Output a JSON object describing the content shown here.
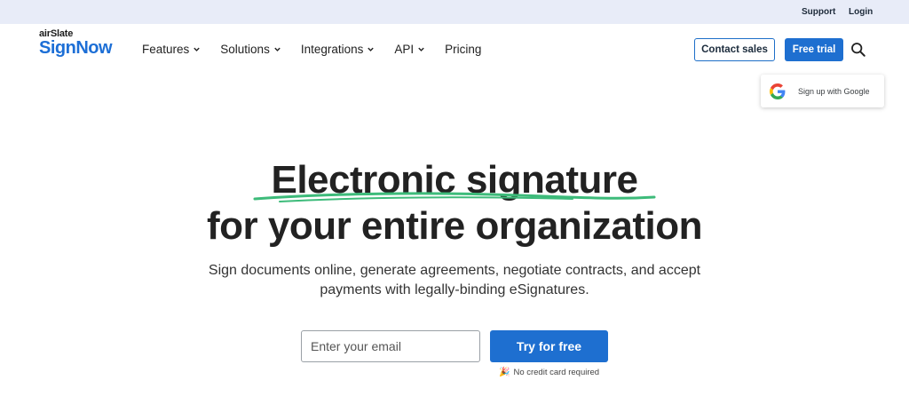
{
  "topbar": {
    "support": "Support",
    "login": "Login"
  },
  "logo": {
    "small": "airSlate",
    "big": "SignNow"
  },
  "nav": {
    "items": [
      {
        "label": "Features",
        "has_dropdown": true
      },
      {
        "label": "Solutions",
        "has_dropdown": true
      },
      {
        "label": "Integrations",
        "has_dropdown": true
      },
      {
        "label": "API",
        "has_dropdown": true
      },
      {
        "label": "Pricing",
        "has_dropdown": false
      }
    ]
  },
  "header_actions": {
    "contact_sales": "Contact sales",
    "free_trial": "Free trial",
    "search_icon": "search-icon"
  },
  "google_signup": {
    "label": "Sign up with Google",
    "icon": "google-icon"
  },
  "hero": {
    "title_line1": "Electronic signature",
    "title_line2": "for your entire organization",
    "subtitle_line1": "Sign documents online, generate agreements, negotiate contracts, and accept",
    "subtitle_line2": "payments with legally-binding eSignatures."
  },
  "signup_form": {
    "email_placeholder": "Enter your email",
    "email_value": "",
    "try_button": "Try for free",
    "note": "No credit card required",
    "note_icon": "party-popper-icon"
  },
  "colors": {
    "brand_blue": "#1e6fd0",
    "topbar_bg": "#e8ecf8",
    "underline_green": "#3dbb7a"
  }
}
